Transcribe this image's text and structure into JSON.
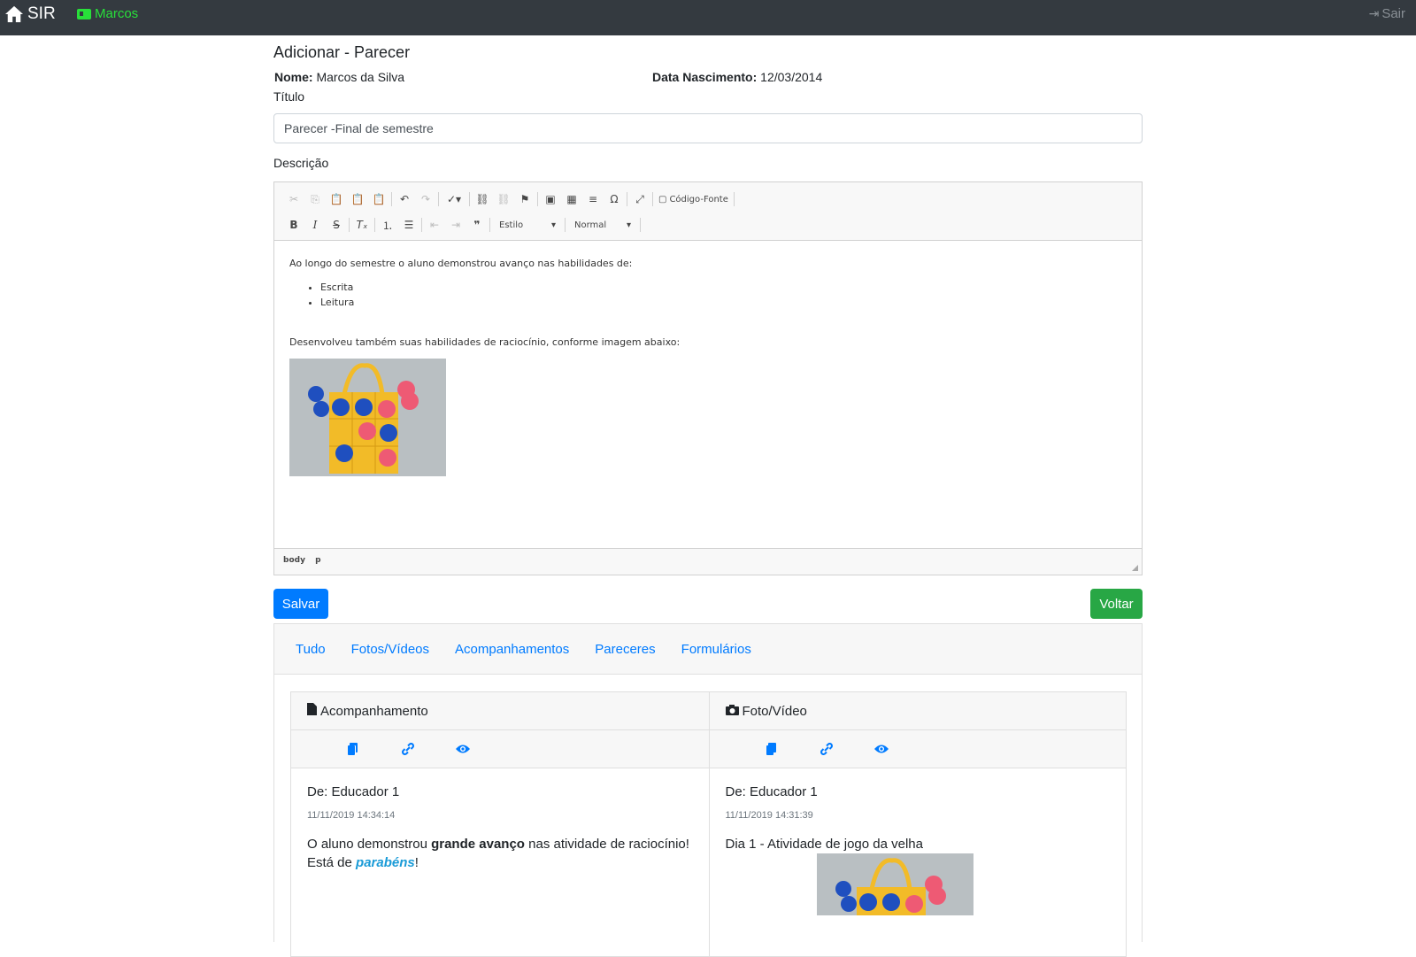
{
  "navbar": {
    "brand": "SIR",
    "user": "Marcos",
    "logout": "Sair"
  },
  "page": {
    "title": "Adicionar - Parecer",
    "name_label": "Nome:",
    "name_value": "Marcos da Silva",
    "birth_label": "Data Nascimento:",
    "birth_value": "12/03/2014",
    "titulo_label": "Título",
    "titulo_value": "Parecer -Final de semestre",
    "descricao_label": "Descrição"
  },
  "editor": {
    "source_label": "Código-Fonte",
    "style_combo": "Estilo",
    "format_combo": "Normal",
    "paragraph1": "Ao longo do semestre o aluno demonstrou avanço nas habilidades de:",
    "list": [
      "Escrita",
      "Leitura"
    ],
    "paragraph2": "Desenvolveu também suas habilidades de raciocínio, conforme imagem abaixo:",
    "path": [
      "body",
      "p"
    ]
  },
  "buttons": {
    "save": "Salvar",
    "back": "Voltar"
  },
  "tabs": [
    "Tudo",
    "Fotos/Vídeos",
    "Acompanhamentos",
    "Pareceres",
    "Formulários"
  ],
  "cards": [
    {
      "type": "Acompanhamento",
      "from": "De: Educador 1",
      "date": "11/11/2019 14:34:14",
      "msg_a": "O aluno demonstrou ",
      "msg_b": "grande avanço",
      "msg_c": " nas atividade de raciocínio!",
      "msg_d": "Está de ",
      "msg_e": "parabéns",
      "msg_f": "!"
    },
    {
      "type": "Foto/Vídeo",
      "from": "De: Educador 1",
      "date": "11/11/2019 14:31:39",
      "msg": "Dia 1 - Atividade de jogo da velha"
    }
  ],
  "colors": {
    "navbar": "#343a40",
    "primary": "#007bff",
    "success": "#28a745",
    "user_link": "#28e03a"
  }
}
